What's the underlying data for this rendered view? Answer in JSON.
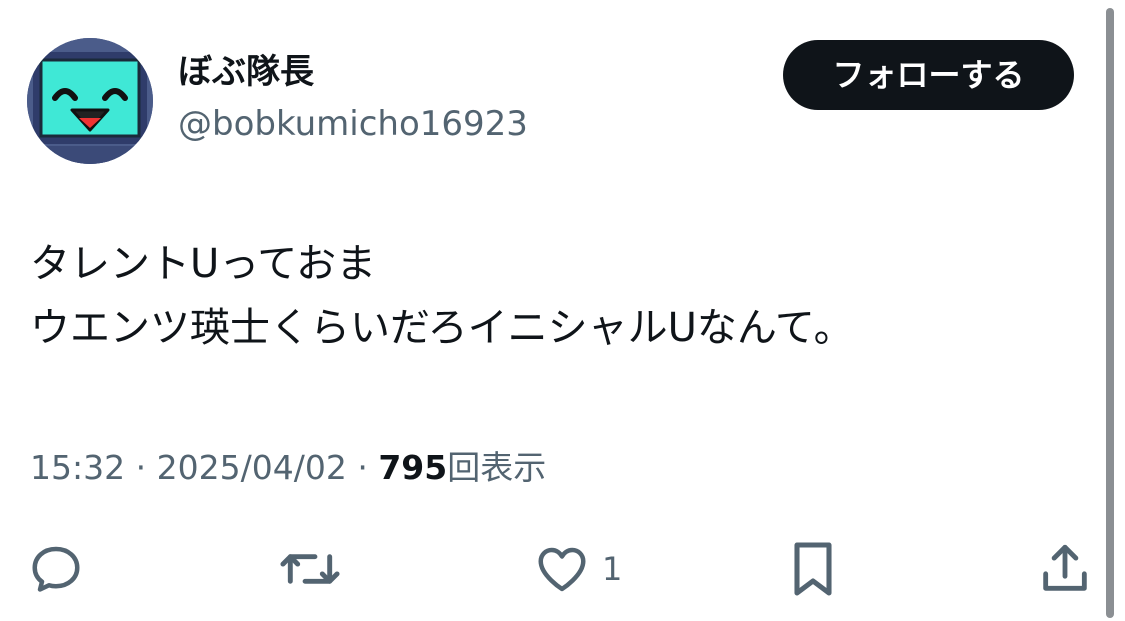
{
  "author": {
    "display_name": "ぼぶ隊長",
    "handle": "@bobkumicho16923",
    "avatar_icon": "smiley-monitor-avatar"
  },
  "follow_button": {
    "label": "フォローする"
  },
  "tweet": {
    "lines": [
      "タレントUっておま",
      "ウエンツ瑛士くらいだろイニシャルUなんて。"
    ]
  },
  "meta": {
    "time": "15:32",
    "separator": "·",
    "date": "2025/04/02",
    "views_count": "795",
    "views_label": "回表示"
  },
  "actions": {
    "reply_icon": "reply-icon",
    "retweet_icon": "retweet-icon",
    "like_icon": "heart-icon",
    "like_count": "1",
    "bookmark_icon": "bookmark-icon",
    "share_icon": "share-icon"
  },
  "colors": {
    "text_primary": "#0f1419",
    "text_secondary": "#536471",
    "button_bg": "#0f1419",
    "avatar_screen": "#3fe8d6"
  }
}
